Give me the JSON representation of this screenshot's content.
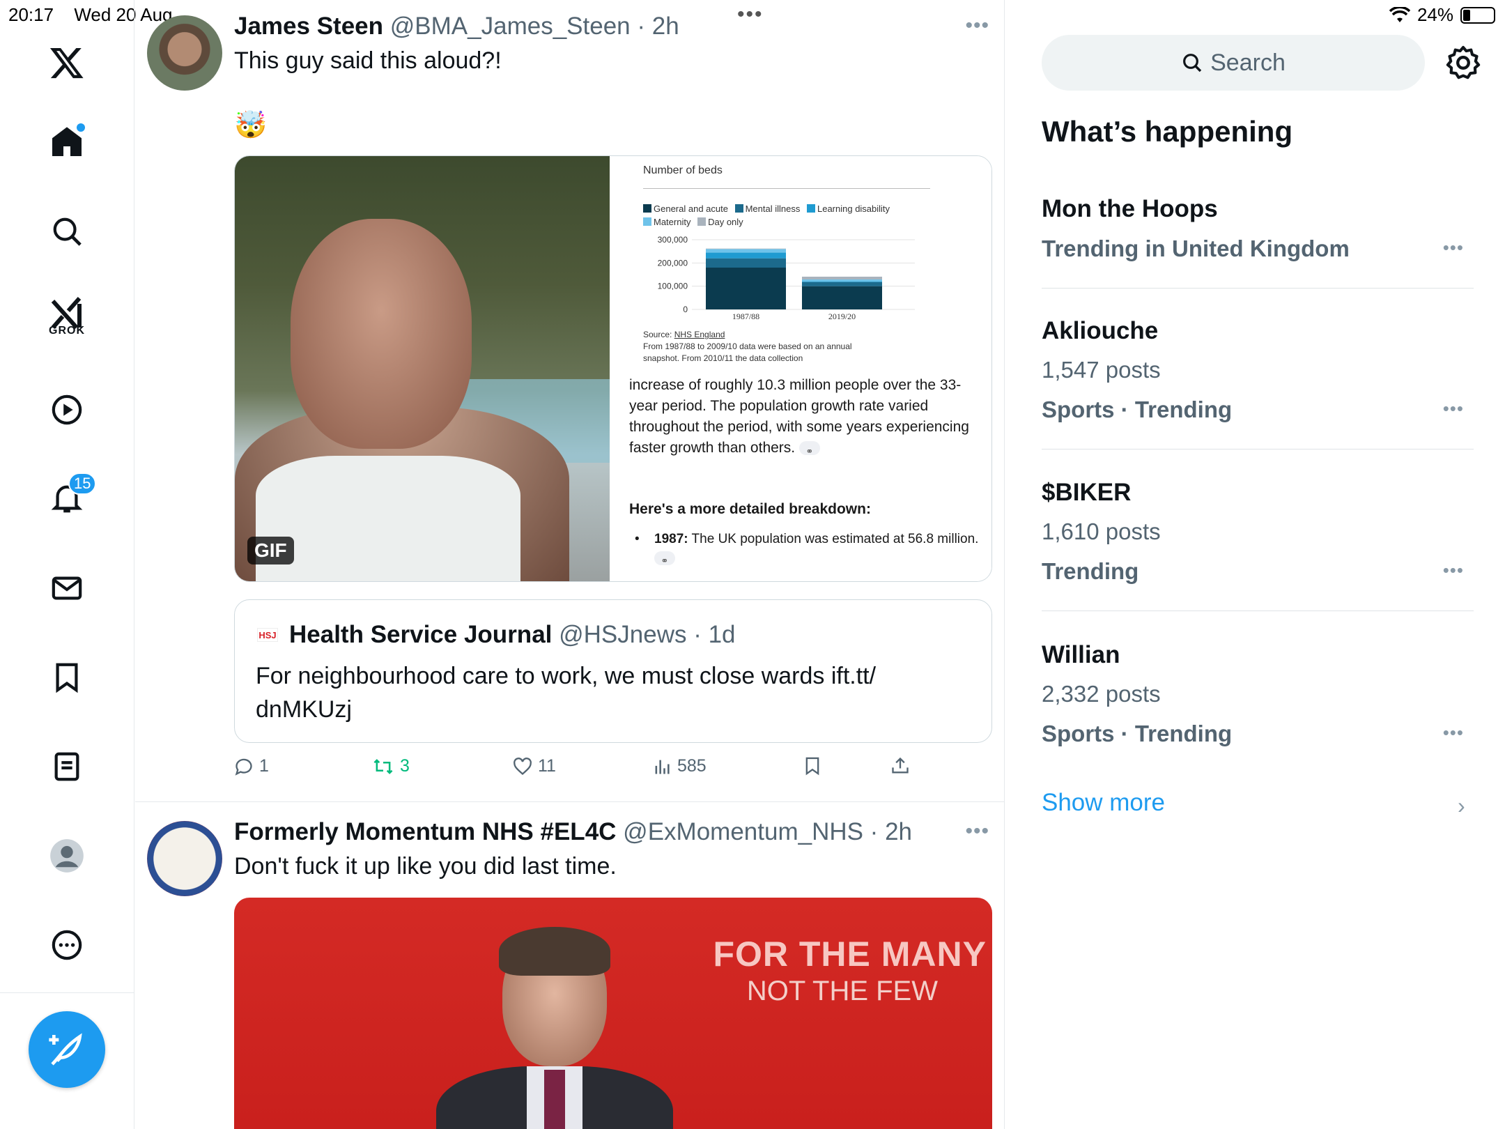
{
  "status_bar": {
    "time": "20:17",
    "date": "Wed 20 Aug",
    "battery": "24%",
    "battery_level": 0.24
  },
  "nav": {
    "grok_label": "GROK",
    "notifications_badge": "15",
    "items": [
      "home-icon",
      "search-icon",
      "grok-icon",
      "video-icon",
      "notifications-icon",
      "messages-icon",
      "bookmarks-icon",
      "lists-icon",
      "profile-icon",
      "more-icon"
    ]
  },
  "tweet1": {
    "name": "James Steen",
    "meta": "@BMA_James_Steen · 2h",
    "text": "This guy said this aloud?!",
    "emoji": "🤯",
    "gif_label": "GIF",
    "doc": {
      "chart_head": "Number of beds",
      "legend": [
        "General and acute",
        "Mental illness",
        "Learning disability",
        "Maternity",
        "Day only"
      ],
      "source": "Source: ",
      "source_link": "NHS England",
      "source_note": "From 1987/88 to 2009/10 data were based on an annual snapshot. From 2010/11 the data collection",
      "paragraph": "increase of roughly 10.3 million people over the 33-year period. The population growth rate varied throughout the period, with some years experiencing faster growth than others.",
      "subheading": "Here's a more detailed breakdown:",
      "bullet_bold": "1987:",
      "bullet_text": " The UK population was estimated at 56.8 million."
    },
    "quote": {
      "logo": "HSJ",
      "name": "Health Service Journal",
      "meta": "@HSJnews · 1d",
      "text": "For neighbourhood care to work, we must close wards ift.tt/ dnMKUzj"
    },
    "actions": {
      "replies": "1",
      "reposts": "3",
      "likes": "11",
      "views": "585"
    }
  },
  "tweet2": {
    "name": "Formerly Momentum NHS #EL4C",
    "meta": "@ExMomentum_NHS · 2h",
    "text": "Don't fuck it up like you did last time.",
    "media_title": "FOR THE MANY",
    "media_subtitle": "NOT THE FEW"
  },
  "chart_data": {
    "type": "bar",
    "title": "Number of beds",
    "categories": [
      "1987/88",
      "2019/20"
    ],
    "yticks": [
      "300,000",
      "200,000",
      "100,000",
      "0"
    ],
    "ylim": [
      0,
      300000
    ],
    "series": [
      {
        "name": "General and acute",
        "values": [
          180000,
          100000
        ],
        "color": "#0b3b4f"
      },
      {
        "name": "Mental illness",
        "values": [
          40000,
          18000
        ],
        "color": "#1c6a8c"
      },
      {
        "name": "Learning disability",
        "values": [
          25000,
          3000
        ],
        "color": "#1f9bd1"
      },
      {
        "name": "Maternity",
        "values": [
          15000,
          8000
        ],
        "color": "#6fc3ea"
      },
      {
        "name": "Day only",
        "values": [
          2000,
          12000
        ],
        "color": "#a9b3bd"
      }
    ]
  },
  "right": {
    "search_placeholder": "Search",
    "whats_happening": "What’s happening",
    "trends": [
      {
        "name": "Mon the Hoops",
        "line1": "Trending in United Kingdom",
        "line2": ""
      },
      {
        "name": "Akliouche",
        "line1": "1,547 posts",
        "line2": "Sports · Trending"
      },
      {
        "name": "$BIKER",
        "line1": "1,610 posts",
        "line2": "Trending"
      },
      {
        "name": "Willian",
        "line1": "2,332 posts",
        "line2": "Sports · Trending"
      }
    ],
    "show_more": "Show more"
  },
  "colors": {
    "accent": "#1d9bf0",
    "repost_green": "#00ba7c",
    "text_secondary": "#536471"
  }
}
